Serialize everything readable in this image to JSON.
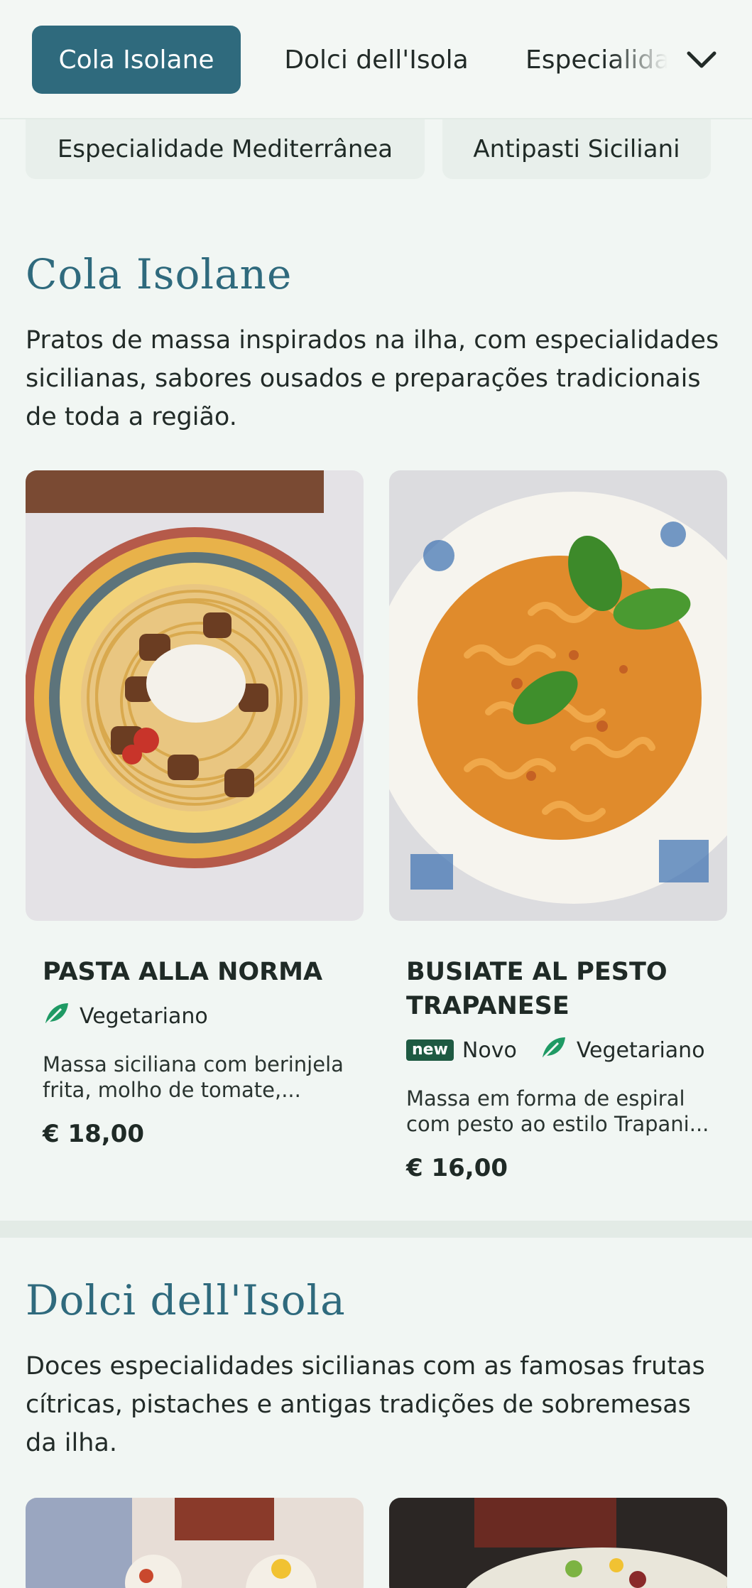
{
  "nav": {
    "tabs": [
      {
        "label": "Cola Isolane",
        "active": true
      },
      {
        "label": "Dolci dell'Isola",
        "active": false
      },
      {
        "label": "Especialidade Mediterrânea",
        "active": false
      }
    ],
    "more_icon": "chevron-down-icon"
  },
  "subnav": {
    "chips": [
      "Especialidade Mediterrânea",
      "Antipasti Siciliani"
    ]
  },
  "sections": [
    {
      "title": "Cola Isolane",
      "description": "Pratos de massa inspirados na ilha, com especialidades sicilianas, sabores ousados e preparações tradicionais de toda a região.",
      "items": [
        {
          "name": "PASTA ALLA NORMA",
          "tags": [
            {
              "icon": "vegetarian-leaf-icon",
              "label": "Vegetariano"
            }
          ],
          "description": "Massa siciliana com berinjela frita, molho de tomate,...",
          "price": "€ 18,00"
        },
        {
          "name": "BUSIATE AL PESTO TRAPANESE",
          "badge": "new",
          "tags": [
            {
              "label": "Novo"
            },
            {
              "icon": "vegetarian-leaf-icon",
              "label": "Vegetariano"
            }
          ],
          "description": "Massa em forma de espiral com pesto ao estilo Trapani...",
          "price": "€ 16,00"
        }
      ]
    },
    {
      "title": "Dolci dell'Isola",
      "description": "Doces especialidades sicilianas com as famosas frutas cítricas, pistaches e antigas tradições de sobremesas da ilha."
    }
  ],
  "colors": {
    "accent": "#2f6a7d",
    "background": "#f1f6f3",
    "vegetarian_green": "#1f9a64",
    "new_badge": "#1e5a42"
  }
}
